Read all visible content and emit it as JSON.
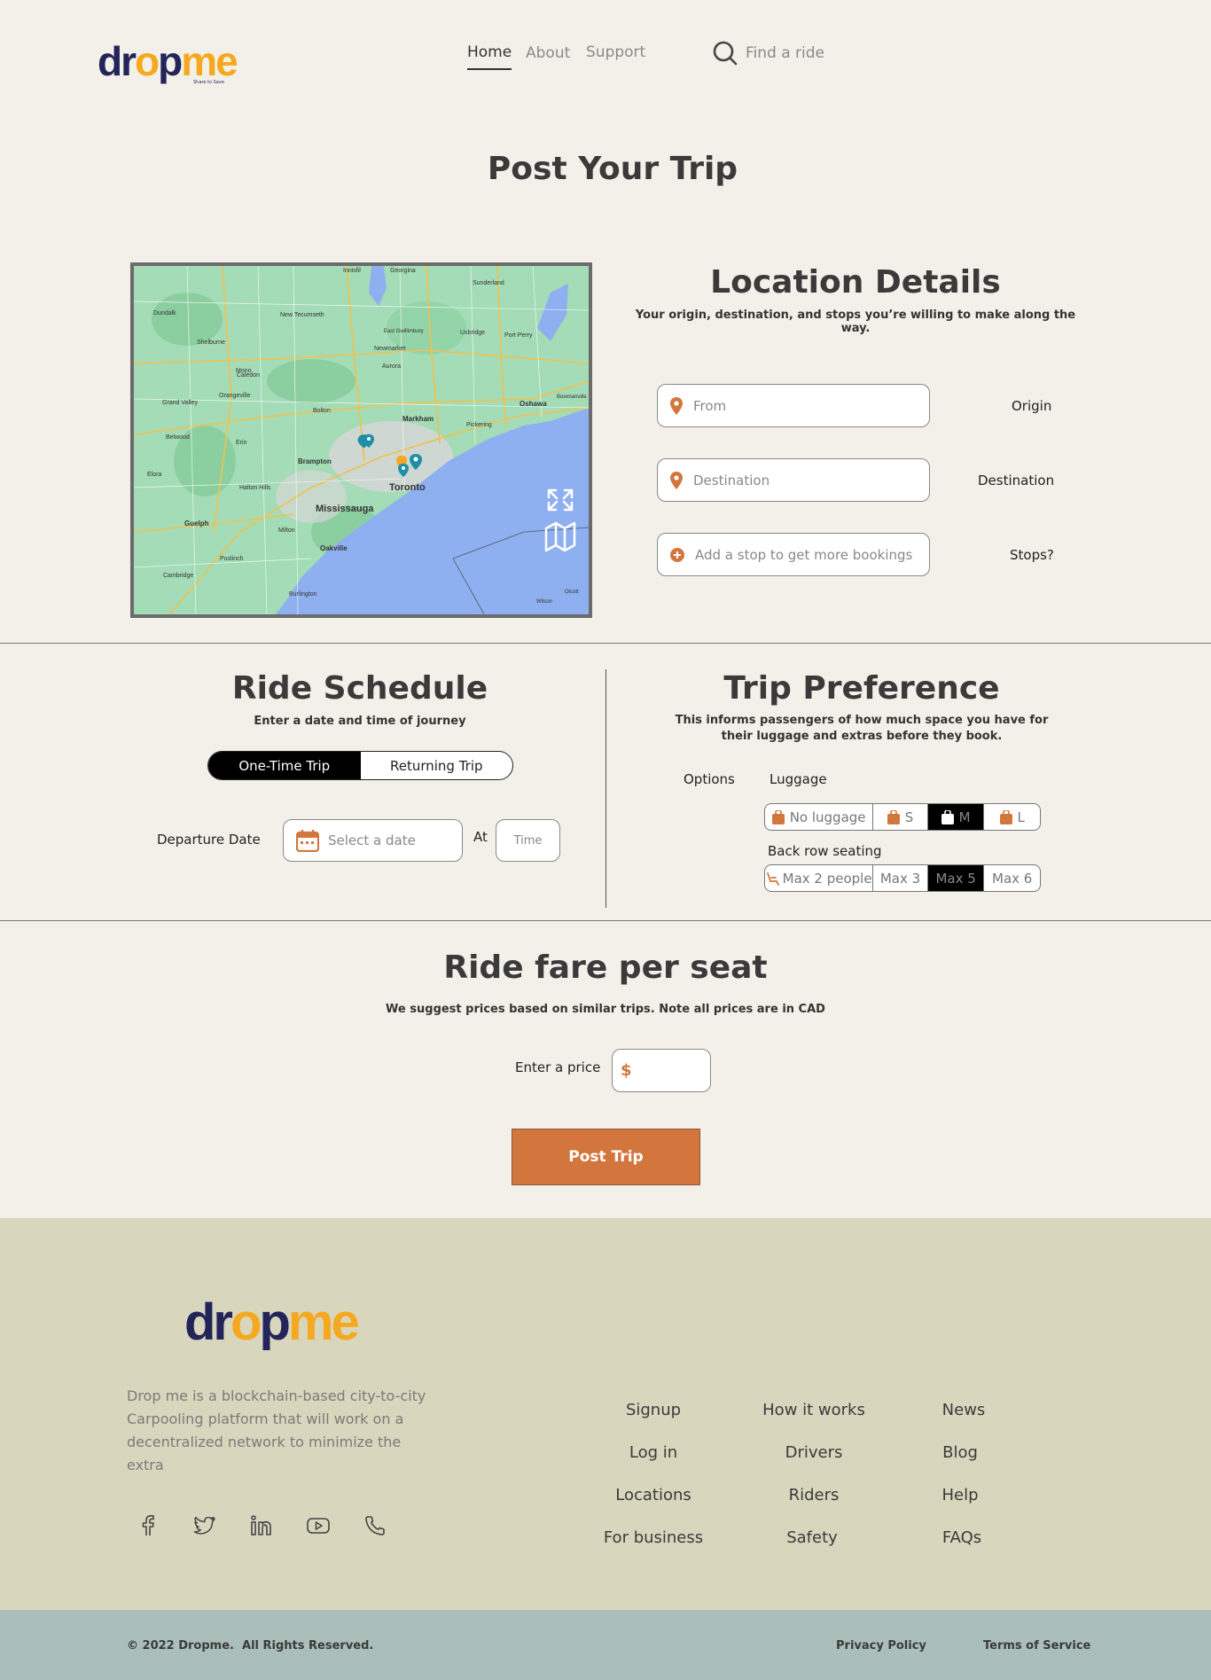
{
  "header": {
    "logo": {
      "d": "dr",
      "o": "o",
      "p": "p",
      "me": "me",
      "tagline": "Share to Save"
    },
    "nav": [
      {
        "label": "Home",
        "active": true
      },
      {
        "label": "About",
        "active": false
      },
      {
        "label": "Support",
        "active": false
      }
    ],
    "search_placeholder": "Find a ride"
  },
  "page_title": "Post Your Trip",
  "location": {
    "title": "Location Details",
    "subtitle": "Your origin, destination, and stops you’re willing to make along the way.",
    "fields": [
      {
        "placeholder": "From",
        "label": "Origin"
      },
      {
        "placeholder": "Destination",
        "label": "Destination"
      },
      {
        "placeholder": "Add a stop to get more bookings",
        "label": "Stops?"
      }
    ]
  },
  "map": {
    "places": [
      "Toronto",
      "Mississauga",
      "Brampton",
      "Markham",
      "Oakville",
      "Burlington",
      "Guelph",
      "Milton",
      "Oshawa",
      "Pickering",
      "Newmarket",
      "Aurora",
      "Bolton",
      "Caledon",
      "Uxbridge",
      "Orangeville",
      "Cambridge",
      "Halton Hills",
      "Grand Valley",
      "Shelburne",
      "Georgina",
      "Sunderland",
      "Port Perry",
      "Innisfil",
      "Dundalk",
      "New Tecumseth",
      "East Gwillimbury",
      "Mono",
      "Erin",
      "Belwood",
      "Elora",
      "Puslinch",
      "Bowmanville",
      "Wilson",
      "Olcott"
    ]
  },
  "schedule": {
    "title": "Ride Schedule",
    "subtitle": "Enter a date and time of journey",
    "trip_types": [
      "One-Time Trip",
      "Returning Trip"
    ],
    "departure_label": "Departure Date",
    "date_placeholder": "Select a date",
    "at_label": "At",
    "time_placeholder": "Time"
  },
  "preference": {
    "title": "Trip Preference",
    "subtitle": "This informs passengers of how much space you have for their luggage and extras before they book.",
    "options_label": "Options",
    "luggage_label": "Luggage",
    "luggage_options": [
      "No luggage",
      "S",
      "M",
      "L"
    ],
    "luggage_selected": 2,
    "seating_label": "Back row seating",
    "seating_options": [
      "Max 2 people",
      "Max 3",
      "Max 5",
      "Max 6"
    ],
    "seating_selected": 2
  },
  "fare": {
    "title": "Ride fare per seat",
    "subtitle": "We suggest prices based on similar trips. Note all prices are in CAD",
    "price_label": "Enter a price",
    "currency_symbol": "$",
    "post_button": "Post Trip"
  },
  "footer": {
    "description": "Drop me is a blockchain-based city-to-city Carpooling platform that will work on a decentralized network to minimize the extra",
    "columns": [
      [
        "Signup",
        "Log in",
        "Locations",
        "For business"
      ],
      [
        "How it works",
        "Drivers",
        "Riders",
        "Safety"
      ],
      [
        "News",
        "Blog",
        "Help",
        "FAQs"
      ]
    ],
    "social_icons": [
      "facebook-icon",
      "twitter-icon",
      "linkedin-icon",
      "youtube-icon",
      "phone-icon"
    ],
    "copyright": "© 2022 Dropme.  All Rights Reserved.",
    "privacy": "Privacy Policy",
    "terms": "Terms of Service"
  },
  "colors": {
    "background": "#f2f0e8",
    "accent": "#d3763d",
    "logo_dark": "#23245a",
    "logo_yellow": "#f6a91f",
    "footer_bg": "#d9d6be",
    "footer_bottom_bg": "#aabfb9",
    "map_water": "#8fb0f0",
    "map_land": "#9fd8b4"
  }
}
